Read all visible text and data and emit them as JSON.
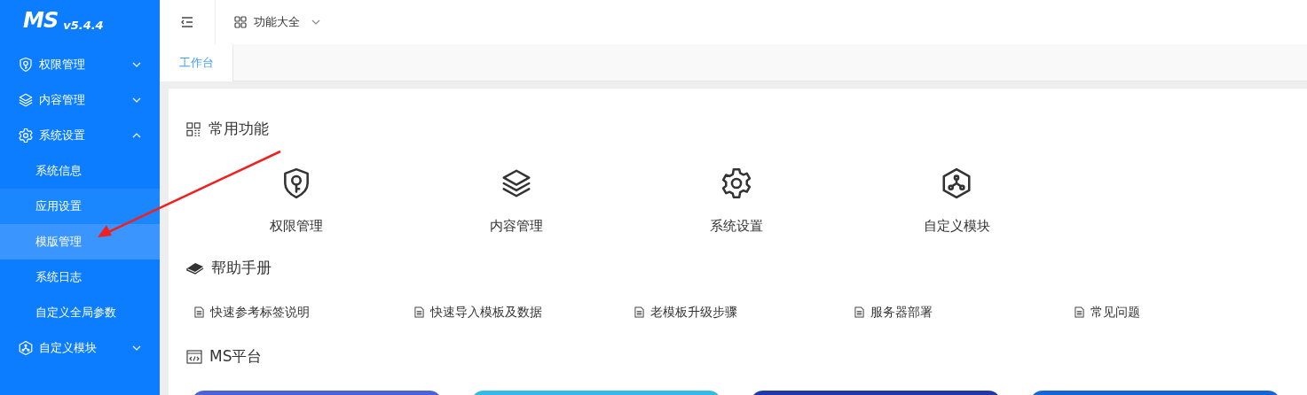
{
  "sidebar": {
    "logo": "MS",
    "version": "v5.4.4",
    "items": [
      {
        "label": "权限管理",
        "kind": "shield",
        "expanded": false
      },
      {
        "label": "内容管理",
        "kind": "layers",
        "expanded": false
      },
      {
        "label": "系统设置",
        "kind": "gear",
        "expanded": true,
        "children": [
          {
            "label": "系统信息",
            "selected": false,
            "hovered": false
          },
          {
            "label": "应用设置",
            "selected": false,
            "hovered": true
          },
          {
            "label": "模版管理",
            "selected": true,
            "hovered": false
          },
          {
            "label": "系统日志",
            "selected": false,
            "hovered": false
          },
          {
            "label": "自定义全局参数",
            "selected": false,
            "hovered": false
          }
        ]
      },
      {
        "label": "自定义模块",
        "kind": "cube",
        "expanded": false
      }
    ]
  },
  "topbar": {
    "menu_label": "功能大全"
  },
  "tabs": [
    {
      "label": "工作台",
      "selected": true
    }
  ],
  "sections": [
    {
      "kind": "shortcuts",
      "title": "常用功能",
      "items": [
        {
          "label": "权限管理",
          "kind": "shield"
        },
        {
          "label": "内容管理",
          "kind": "layers"
        },
        {
          "label": "系统设置",
          "kind": "gear"
        },
        {
          "label": "自定义模块",
          "kind": "cube"
        }
      ]
    },
    {
      "kind": "links",
      "title": "帮助手册",
      "items": [
        {
          "label": "快速参考标签说明"
        },
        {
          "label": "快速导入模板及数据"
        },
        {
          "label": "老模板升级步骤"
        },
        {
          "label": "服务器部署"
        },
        {
          "label": "常见问题"
        }
      ]
    },
    {
      "kind": "cards",
      "title": "MS平台",
      "items": [
        {
          "color": "#4a63d8"
        },
        {
          "color": "#38b8e8"
        },
        {
          "color": "#1f3aa8"
        },
        {
          "color": "#1565d8"
        }
      ]
    }
  ]
}
